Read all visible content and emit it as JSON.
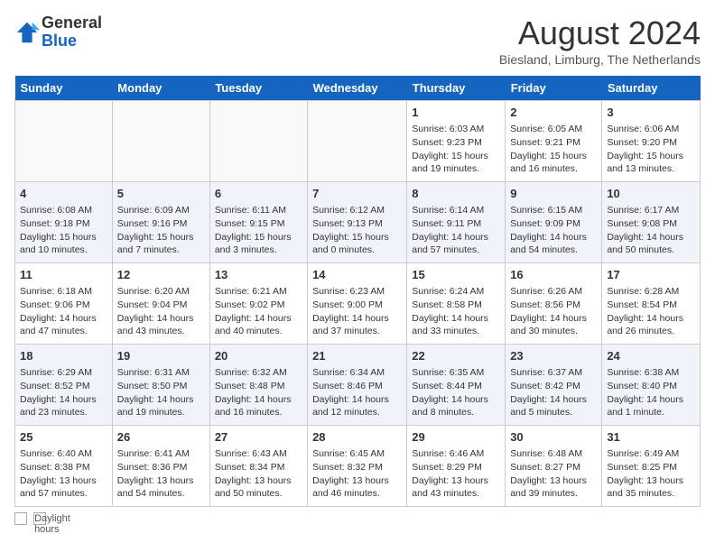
{
  "header": {
    "logo_general": "General",
    "logo_blue": "Blue",
    "month_title": "August 2024",
    "location": "Biesland, Limburg, The Netherlands"
  },
  "days_of_week": [
    "Sunday",
    "Monday",
    "Tuesday",
    "Wednesday",
    "Thursday",
    "Friday",
    "Saturday"
  ],
  "weeks": [
    [
      {
        "day": "",
        "info": ""
      },
      {
        "day": "",
        "info": ""
      },
      {
        "day": "",
        "info": ""
      },
      {
        "day": "",
        "info": ""
      },
      {
        "day": "1",
        "info": "Sunrise: 6:03 AM\nSunset: 9:23 PM\nDaylight: 15 hours\nand 19 minutes."
      },
      {
        "day": "2",
        "info": "Sunrise: 6:05 AM\nSunset: 9:21 PM\nDaylight: 15 hours\nand 16 minutes."
      },
      {
        "day": "3",
        "info": "Sunrise: 6:06 AM\nSunset: 9:20 PM\nDaylight: 15 hours\nand 13 minutes."
      }
    ],
    [
      {
        "day": "4",
        "info": "Sunrise: 6:08 AM\nSunset: 9:18 PM\nDaylight: 15 hours\nand 10 minutes."
      },
      {
        "day": "5",
        "info": "Sunrise: 6:09 AM\nSunset: 9:16 PM\nDaylight: 15 hours\nand 7 minutes."
      },
      {
        "day": "6",
        "info": "Sunrise: 6:11 AM\nSunset: 9:15 PM\nDaylight: 15 hours\nand 3 minutes."
      },
      {
        "day": "7",
        "info": "Sunrise: 6:12 AM\nSunset: 9:13 PM\nDaylight: 15 hours\nand 0 minutes."
      },
      {
        "day": "8",
        "info": "Sunrise: 6:14 AM\nSunset: 9:11 PM\nDaylight: 14 hours\nand 57 minutes."
      },
      {
        "day": "9",
        "info": "Sunrise: 6:15 AM\nSunset: 9:09 PM\nDaylight: 14 hours\nand 54 minutes."
      },
      {
        "day": "10",
        "info": "Sunrise: 6:17 AM\nSunset: 9:08 PM\nDaylight: 14 hours\nand 50 minutes."
      }
    ],
    [
      {
        "day": "11",
        "info": "Sunrise: 6:18 AM\nSunset: 9:06 PM\nDaylight: 14 hours\nand 47 minutes."
      },
      {
        "day": "12",
        "info": "Sunrise: 6:20 AM\nSunset: 9:04 PM\nDaylight: 14 hours\nand 43 minutes."
      },
      {
        "day": "13",
        "info": "Sunrise: 6:21 AM\nSunset: 9:02 PM\nDaylight: 14 hours\nand 40 minutes."
      },
      {
        "day": "14",
        "info": "Sunrise: 6:23 AM\nSunset: 9:00 PM\nDaylight: 14 hours\nand 37 minutes."
      },
      {
        "day": "15",
        "info": "Sunrise: 6:24 AM\nSunset: 8:58 PM\nDaylight: 14 hours\nand 33 minutes."
      },
      {
        "day": "16",
        "info": "Sunrise: 6:26 AM\nSunset: 8:56 PM\nDaylight: 14 hours\nand 30 minutes."
      },
      {
        "day": "17",
        "info": "Sunrise: 6:28 AM\nSunset: 8:54 PM\nDaylight: 14 hours\nand 26 minutes."
      }
    ],
    [
      {
        "day": "18",
        "info": "Sunrise: 6:29 AM\nSunset: 8:52 PM\nDaylight: 14 hours\nand 23 minutes."
      },
      {
        "day": "19",
        "info": "Sunrise: 6:31 AM\nSunset: 8:50 PM\nDaylight: 14 hours\nand 19 minutes."
      },
      {
        "day": "20",
        "info": "Sunrise: 6:32 AM\nSunset: 8:48 PM\nDaylight: 14 hours\nand 16 minutes."
      },
      {
        "day": "21",
        "info": "Sunrise: 6:34 AM\nSunset: 8:46 PM\nDaylight: 14 hours\nand 12 minutes."
      },
      {
        "day": "22",
        "info": "Sunrise: 6:35 AM\nSunset: 8:44 PM\nDaylight: 14 hours\nand 8 minutes."
      },
      {
        "day": "23",
        "info": "Sunrise: 6:37 AM\nSunset: 8:42 PM\nDaylight: 14 hours\nand 5 minutes."
      },
      {
        "day": "24",
        "info": "Sunrise: 6:38 AM\nSunset: 8:40 PM\nDaylight: 14 hours\nand 1 minute."
      }
    ],
    [
      {
        "day": "25",
        "info": "Sunrise: 6:40 AM\nSunset: 8:38 PM\nDaylight: 13 hours\nand 57 minutes."
      },
      {
        "day": "26",
        "info": "Sunrise: 6:41 AM\nSunset: 8:36 PM\nDaylight: 13 hours\nand 54 minutes."
      },
      {
        "day": "27",
        "info": "Sunrise: 6:43 AM\nSunset: 8:34 PM\nDaylight: 13 hours\nand 50 minutes."
      },
      {
        "day": "28",
        "info": "Sunrise: 6:45 AM\nSunset: 8:32 PM\nDaylight: 13 hours\nand 46 minutes."
      },
      {
        "day": "29",
        "info": "Sunrise: 6:46 AM\nSunset: 8:29 PM\nDaylight: 13 hours\nand 43 minutes."
      },
      {
        "day": "30",
        "info": "Sunrise: 6:48 AM\nSunset: 8:27 PM\nDaylight: 13 hours\nand 39 minutes."
      },
      {
        "day": "31",
        "info": "Sunrise: 6:49 AM\nSunset: 8:25 PM\nDaylight: 13 hours\nand 35 minutes."
      }
    ]
  ],
  "footer": {
    "daylight_label": "Daylight hours"
  }
}
